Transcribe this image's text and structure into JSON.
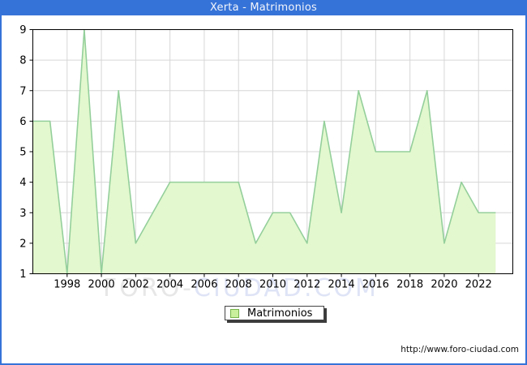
{
  "title": "Xerta - Matrimonios",
  "source_url": "http://www.foro-ciudad.com",
  "watermark": {
    "part1": "FORO-",
    "part2": "CIUDAD.COM"
  },
  "legend": {
    "label": "Matrimonios"
  },
  "colors": {
    "frame_blue": "#3673d8",
    "title_text": "#f2f5fb",
    "area_fill": "#e3f8ce",
    "area_line": "#94cf9b",
    "grid": "#d6d6d6",
    "plot_border": "#000000",
    "axis_text": "#000000",
    "legend_swatch_fill": "#c9ef9c",
    "legend_swatch_border": "#76b34a",
    "watermark_gray": "#e7e7e7",
    "watermark_blue": "#dfe4f6"
  },
  "chart_data": {
    "type": "area",
    "title": "Xerta - Matrimonios",
    "series_name": "Matrimonios",
    "x": [
      1996,
      1997,
      1998,
      1999,
      2000,
      2001,
      2002,
      2003,
      2004,
      2005,
      2006,
      2007,
      2008,
      2009,
      2010,
      2011,
      2012,
      2013,
      2014,
      2015,
      2016,
      2017,
      2018,
      2019,
      2020,
      2021,
      2022,
      2023
    ],
    "values": [
      6,
      6,
      1,
      9,
      1,
      7,
      2,
      3,
      4,
      4,
      4,
      4,
      4,
      2,
      3,
      3,
      2,
      6,
      3,
      7,
      5,
      5,
      5,
      7,
      2,
      4,
      3,
      3
    ],
    "ylim": [
      1,
      9
    ],
    "yticks": [
      1,
      2,
      3,
      4,
      5,
      6,
      7,
      8,
      9
    ],
    "xticks": [
      1998,
      2000,
      2002,
      2004,
      2006,
      2008,
      2010,
      2012,
      2014,
      2016,
      2018,
      2020,
      2022
    ],
    "x_axis_start": 1996,
    "x_axis_end": 2024,
    "grid": true,
    "legend_position": "bottom-center"
  }
}
